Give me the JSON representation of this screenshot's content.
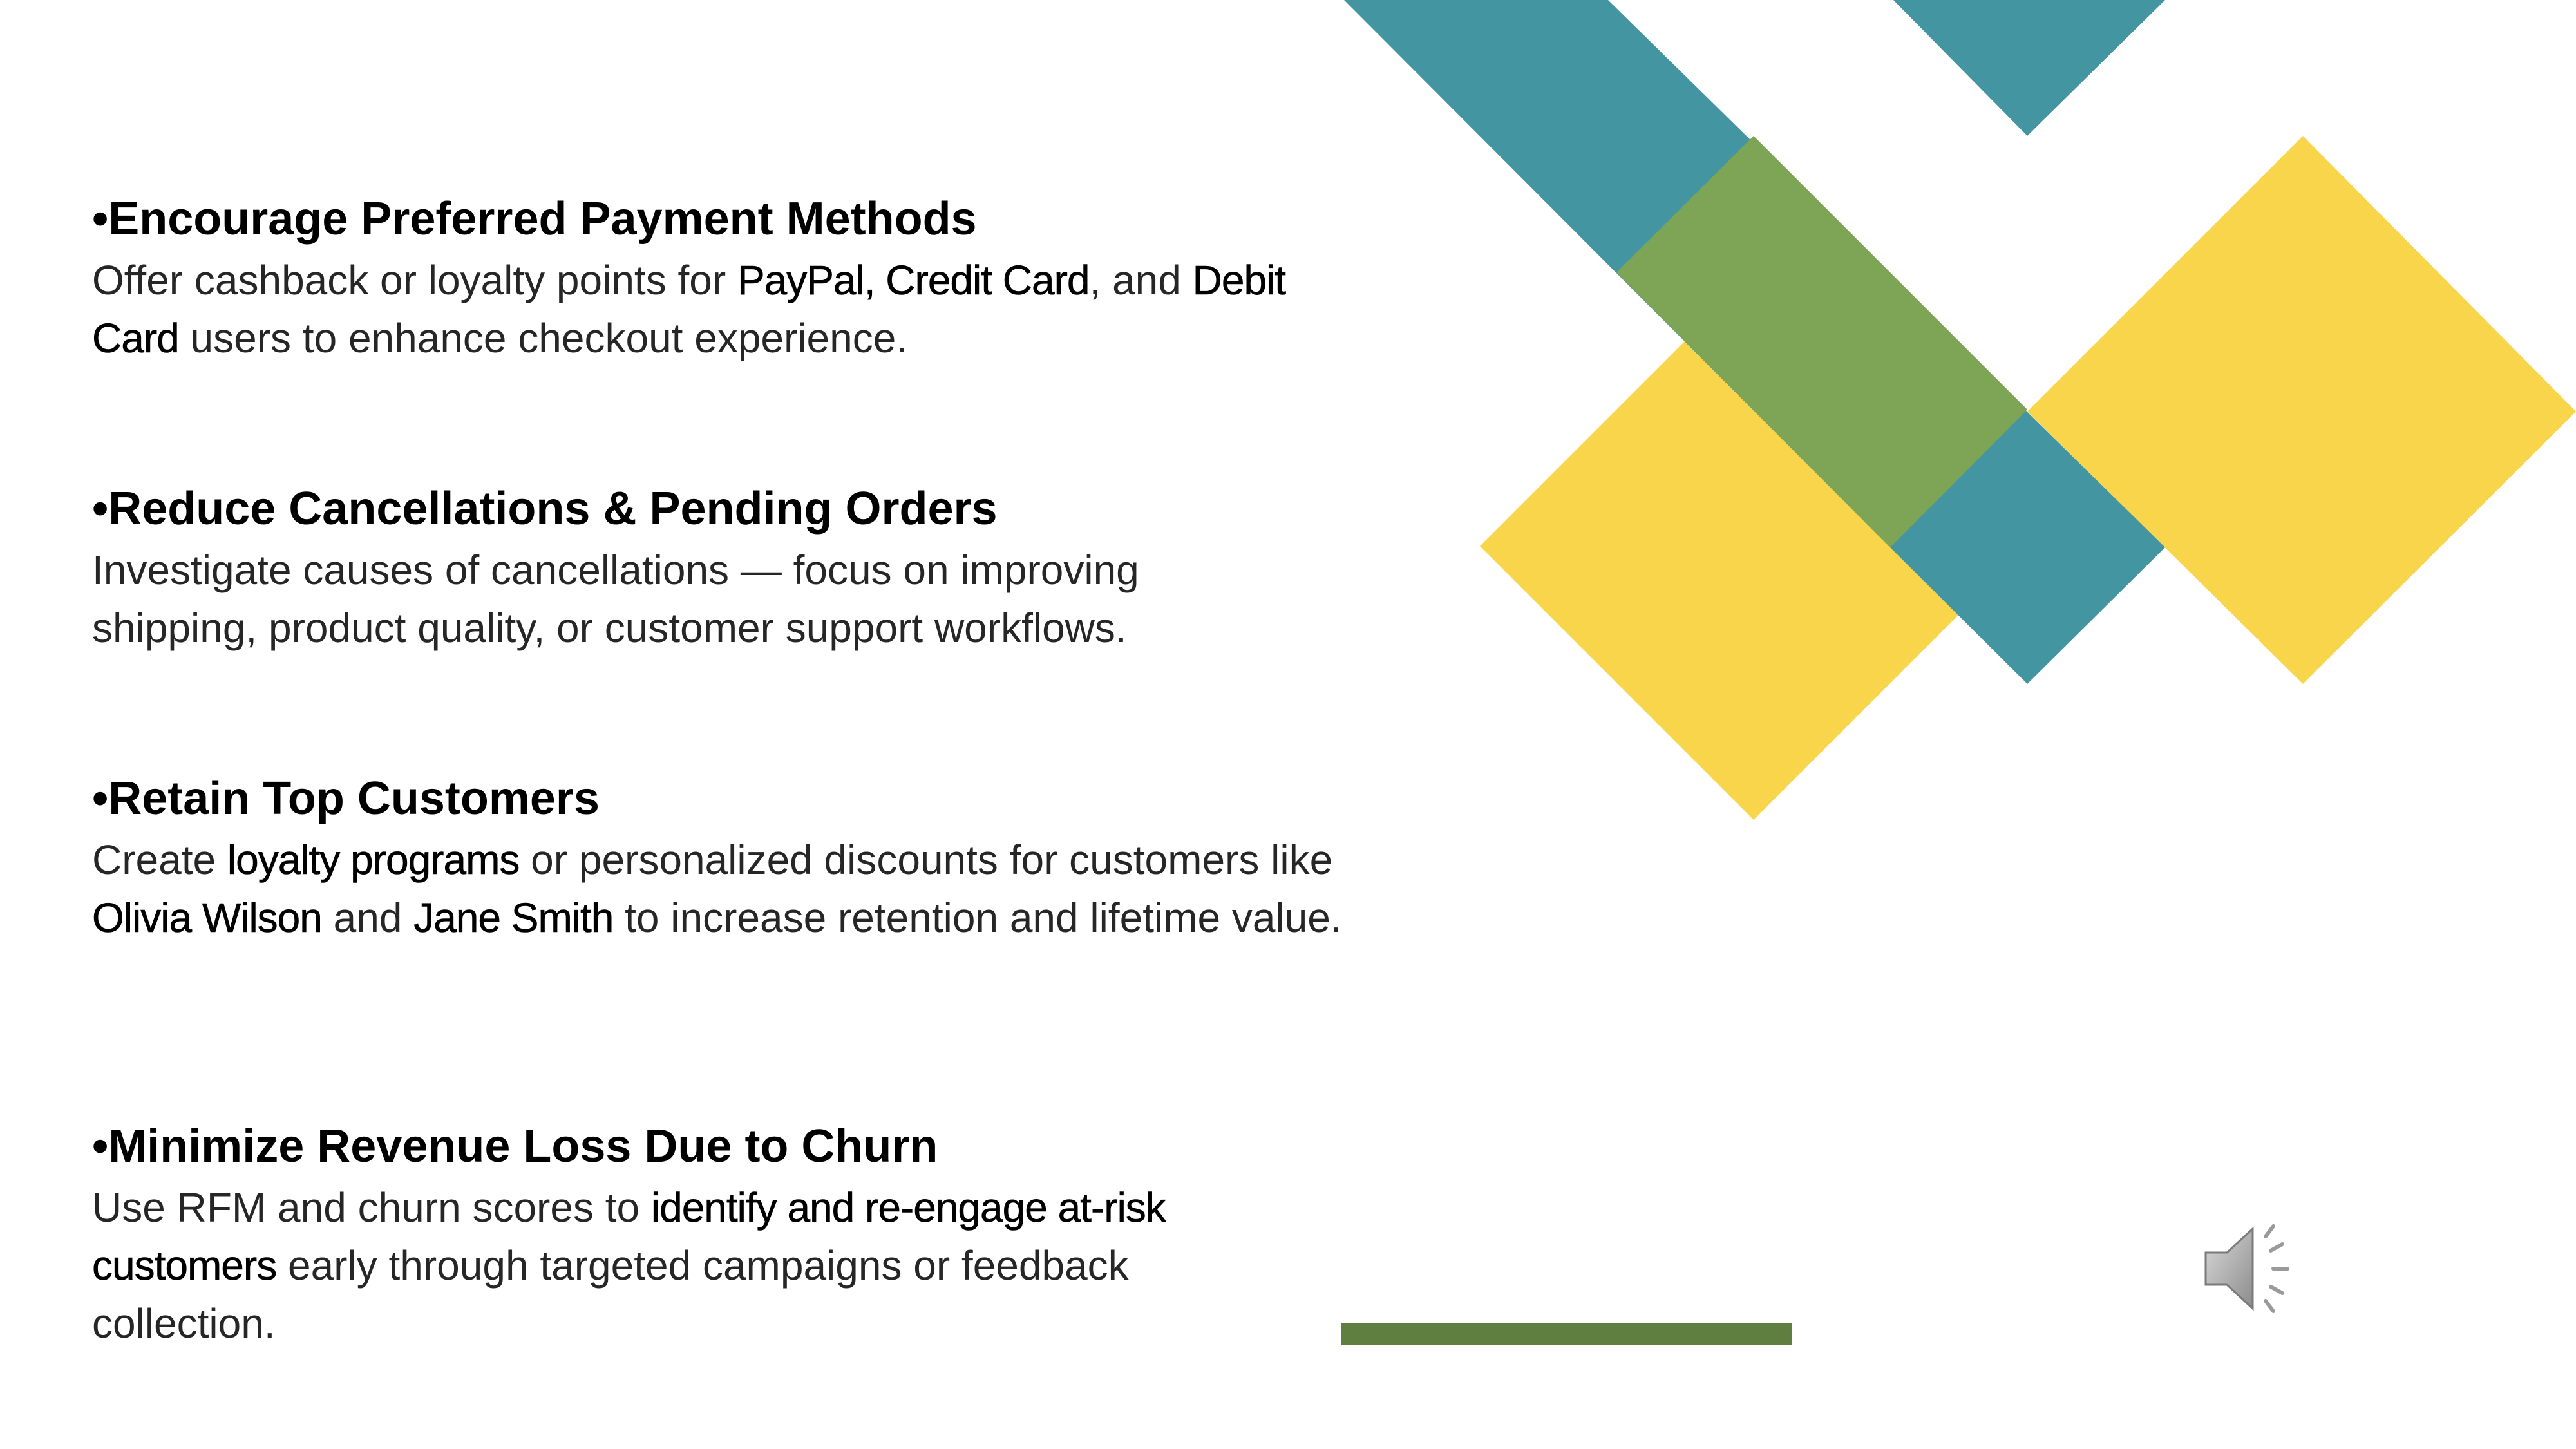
{
  "slide": {
    "points": [
      {
        "heading": "•Encourage Preferred Payment Methods",
        "parts": [
          {
            "t": "Offer cashback or loyalty points for ",
            "b": false
          },
          {
            "t": "PayPal, Credit Card",
            "b": true
          },
          {
            "t": ", and ",
            "b": false
          },
          {
            "t": "Debit Card",
            "b": true
          },
          {
            "t": " users to enhance checkout experience.",
            "b": false
          }
        ]
      },
      {
        "heading": "•Reduce Cancellations & Pending Orders",
        "parts": [
          {
            "t": "Investigate causes of cancellations — focus on improving shipping, product quality, or customer support workflows.",
            "b": false
          }
        ]
      },
      {
        "heading": "•Retain Top Customers",
        "parts": [
          {
            "t": "Create ",
            "b": false
          },
          {
            "t": "loyalty programs",
            "b": true
          },
          {
            "t": " or personalized discounts for customers like ",
            "b": false
          },
          {
            "t": "Olivia Wilson",
            "b": true
          },
          {
            "t": " and ",
            "b": false
          },
          {
            "t": "Jane Smith",
            "b": true
          },
          {
            "t": " to increase retention and lifetime value.",
            "b": false
          }
        ]
      },
      {
        "heading": "•Minimize Revenue Loss Due to Churn",
        "parts": [
          {
            "t": "Use RFM and churn scores to ",
            "b": false
          },
          {
            "t": "identify and re-engage at-risk customers",
            "b": true
          },
          {
            "t": " early through targeted campaigns or feedback collection.",
            "b": false
          }
        ]
      }
    ]
  },
  "decoration": {
    "teal": "#4495a2",
    "yellow": "#f8d54a",
    "green": "#7ea555",
    "accent_bar": "#5e7f3f"
  },
  "media": {
    "audio_icon": "speaker-icon"
  }
}
